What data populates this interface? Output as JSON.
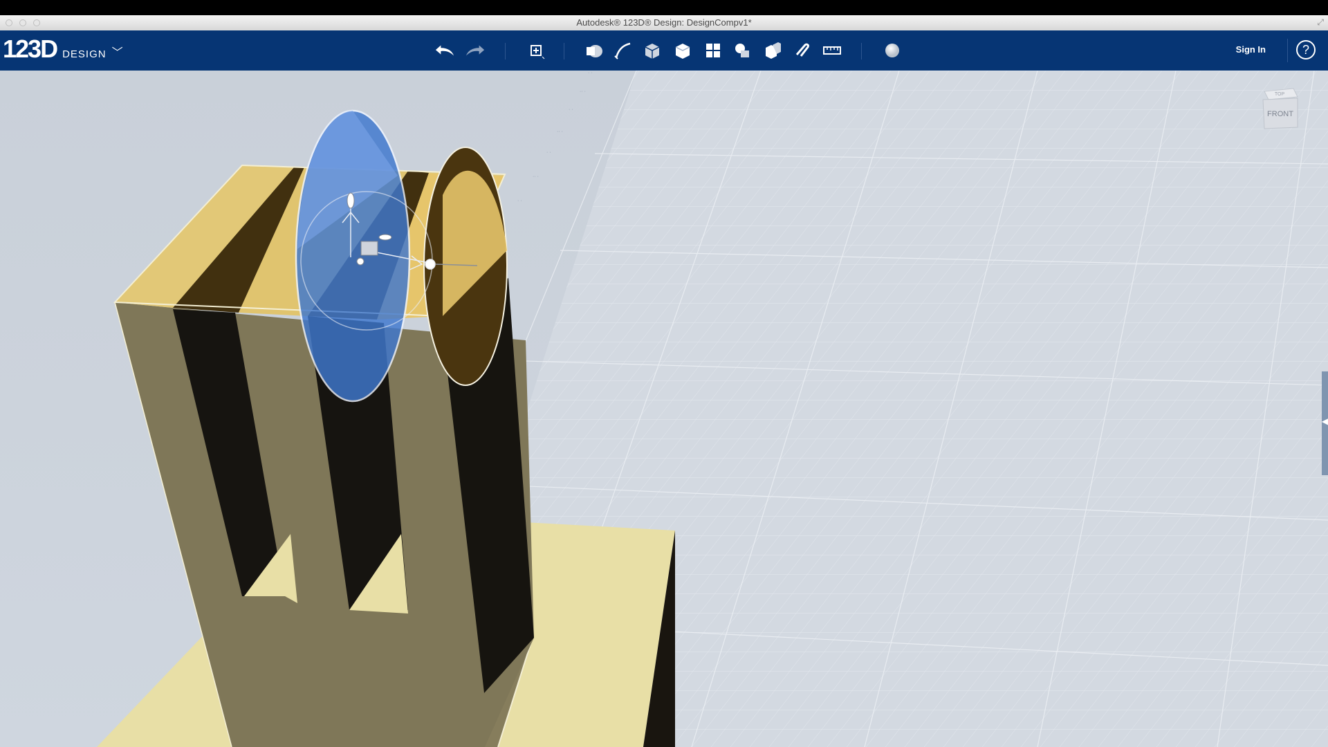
{
  "window": {
    "title": "Autodesk® 123D® Design: DesignCompv1*"
  },
  "app": {
    "logo_number": "123D",
    "logo_text": "DESIGN",
    "menu_chevron": "﹀"
  },
  "toolbar": {
    "tools": [
      {
        "name": "undo-icon"
      },
      {
        "name": "redo-icon"
      },
      {
        "name": "transform-icon"
      },
      {
        "name": "primitives-icon"
      },
      {
        "name": "sketch-icon"
      },
      {
        "name": "construct-icon"
      },
      {
        "name": "modify-icon"
      },
      {
        "name": "pattern-icon"
      },
      {
        "name": "grouping-icon"
      },
      {
        "name": "combine-icon"
      },
      {
        "name": "snap-icon"
      },
      {
        "name": "measure-icon"
      },
      {
        "name": "material-icon"
      }
    ],
    "signin_label": "Sign In",
    "help_label": "?"
  },
  "viewcube": {
    "top_label": "TOP",
    "front_label": "FRONT"
  },
  "colors": {
    "appbar": "#063574",
    "viewport_bg": "#c8d0da",
    "grid_plane": "#d4dae2",
    "selection_blue": "#3f78cf",
    "model_tan": "#e8dfa6",
    "model_dark": "#1a1713"
  }
}
